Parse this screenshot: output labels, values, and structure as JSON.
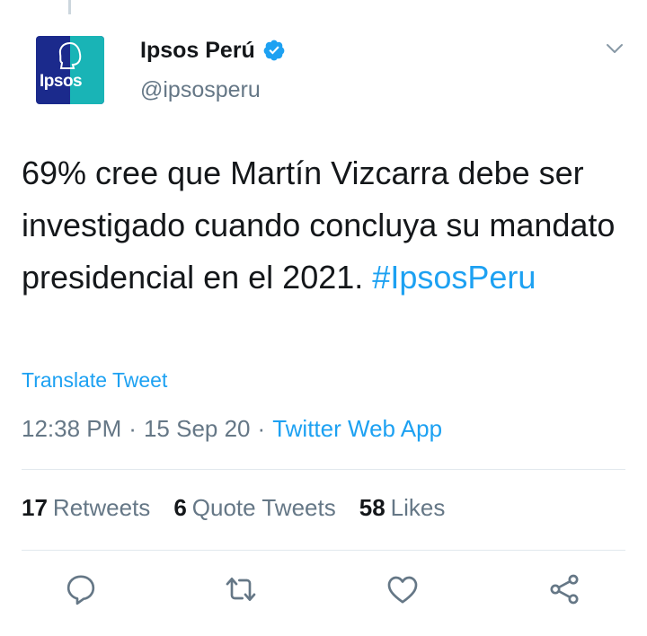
{
  "author": {
    "display_name": "Ipsos Perú",
    "handle": "@ipsosperu",
    "avatar_text": "Ipsos"
  },
  "tweet": {
    "text": "69% cree que Martín Vizcarra debe ser investigado cuando concluya su mandato presidencial en el 2021.",
    "hashtag": "#IpsosPeru",
    "translate_label": "Translate Tweet"
  },
  "meta": {
    "time": "12:38 PM",
    "separator1": "·",
    "date": "15 Sep 20",
    "separator2": "·",
    "source": "Twitter Web App"
  },
  "stats": {
    "retweets_count": "17",
    "retweets_label": "Retweets",
    "quotes_count": "6",
    "quotes_label": "Quote Tweets",
    "likes_count": "58",
    "likes_label": "Likes"
  },
  "icons": {
    "verified": "verified-badge-icon",
    "caret": "chevron-down-icon",
    "reply": "reply-icon",
    "retweet": "retweet-icon",
    "like": "heart-icon",
    "share": "share-icon"
  },
  "colors": {
    "accent": "#1da1f2",
    "secondary_text": "#657786",
    "avatar_blue": "#1b2a8c",
    "avatar_teal": "#19b4b6"
  }
}
